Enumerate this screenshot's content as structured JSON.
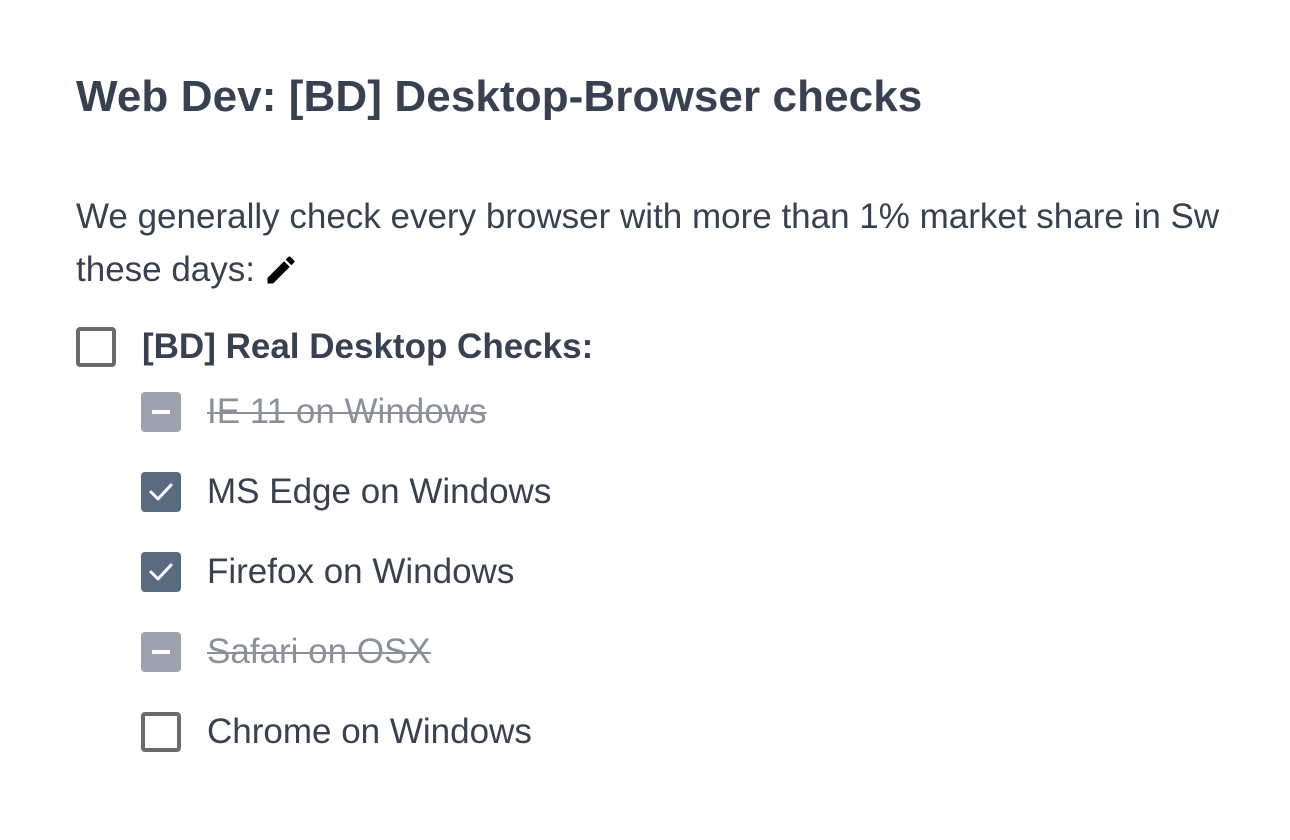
{
  "title": "Web Dev: [BD] Desktop-Browser checks",
  "description": {
    "line1": "We generally check every browser with more than 1% market share in Sw",
    "line2": "these days:"
  },
  "icons": {
    "edit": "pencil-icon",
    "checked": "checkmark-icon",
    "not_applicable": "minus-icon"
  },
  "colors": {
    "text": "#374151",
    "checked_box": "#5b6b7f",
    "na_box": "#9ca3af",
    "struck_text": "#8b919a"
  },
  "checklist": {
    "parent": {
      "label": "[BD] Real Desktop Checks:",
      "state": "unchecked"
    },
    "items": [
      {
        "label": "IE 11 on Windows",
        "state": "not-applicable"
      },
      {
        "label": "MS Edge on Windows",
        "state": "checked"
      },
      {
        "label": "Firefox on Windows",
        "state": "checked"
      },
      {
        "label": "Safari on OSX",
        "state": "not-applicable"
      },
      {
        "label": "Chrome on Windows",
        "state": "unchecked"
      }
    ]
  }
}
